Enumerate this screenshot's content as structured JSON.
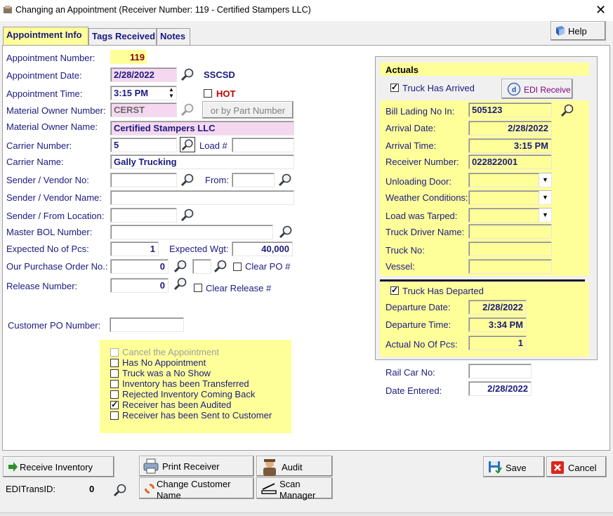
{
  "window": {
    "title": "Changing an Appointment  (Receiver Number: 119 - Certified Stampers LLC)"
  },
  "tabs": [
    "Appointment Info",
    "Tags Received",
    "Notes"
  ],
  "help_button": "Help",
  "form": {
    "appointment_number_label": "Appointment Number:",
    "appointment_number": "119",
    "appointment_date_label": "Appointment Date:",
    "appointment_date": "2/28/2022",
    "user_code": "SSCSD",
    "appointment_time_label": "Appointment Time:",
    "appointment_time": "3:15 PM",
    "hot_label": "HOT",
    "material_owner_number_label": "Material Owner Number:",
    "material_owner_number": "CERST",
    "part_number_button": "or by Part Number",
    "material_owner_name_label": "Material Owner Name:",
    "material_owner_name": "Certified Stampers LLC",
    "carrier_number_label": "Carrier Number:",
    "carrier_number": "5",
    "load_label": "Load #",
    "load_value": "",
    "carrier_name_label": "Carrier Name:",
    "carrier_name": "Gally Trucking",
    "sender_vendor_no_label": "Sender / Vendor No:",
    "sender_vendor_no": "",
    "from_label": "From:",
    "from_value": "",
    "sender_vendor_name_label": "Sender / Vendor Name:",
    "sender_vendor_name": "",
    "sender_from_location_label": "Sender / From Location:",
    "sender_from_location": "",
    "master_bol_label": "Master BOL Number:",
    "master_bol": "",
    "expected_pcs_label": "Expected No of Pcs:",
    "expected_pcs": "1",
    "expected_wgt_label": "Expected Wgt:",
    "expected_wgt": "40,000",
    "purchase_order_label": "Our Purchase Order No.:",
    "purchase_order": "0",
    "purchase_order_2": "",
    "clear_po_label": "Clear PO #",
    "release_number_label": "Release Number:",
    "release_number": "0",
    "clear_release_label": "Clear Release #",
    "customer_po_label": "Customer PO Number:",
    "customer_po": ""
  },
  "status_checks": [
    {
      "label": "Cancel the Appointment",
      "checked": false,
      "disabled": true
    },
    {
      "label": "Has No Appointment",
      "checked": false,
      "disabled": false
    },
    {
      "label": "Truck was a No Show",
      "checked": false,
      "disabled": false
    },
    {
      "label": "Inventory has been Transferred",
      "checked": false,
      "disabled": false
    },
    {
      "label": "Rejected Inventory Coming Back",
      "checked": false,
      "disabled": false
    },
    {
      "label": "Receiver has been Audited",
      "checked": true,
      "disabled": false
    },
    {
      "label": "Receiver has been Sent to Customer",
      "checked": false,
      "disabled": false
    }
  ],
  "actuals": {
    "title": "Actuals",
    "truck_arrived_label": "Truck Has Arrived",
    "edi_receive_button": "EDI Receive",
    "bill_lading_label": "Bill Lading No In:",
    "bill_lading": "505123",
    "arrival_date_label": "Arrival Date:",
    "arrival_date": "2/28/2022",
    "arrival_time_label": "Arrival Time:",
    "arrival_time": "3:15 PM",
    "receiver_number_label": "Receiver Number:",
    "receiver_number": "022822001",
    "unloading_door_label": "Unloading Door:",
    "weather_label": "Weather Conditions:",
    "tarped_label": "Load was Tarped:",
    "driver_name_label": "Truck Driver Name:",
    "truck_no_label": "Truck No:",
    "vessel_label": "Vessel:",
    "truck_departed_label": "Truck Has Departed",
    "departure_date_label": "Departure Date:",
    "departure_date": "2/28/2022",
    "departure_time_label": "Departure Time:",
    "departure_time": "3:34 PM",
    "actual_pcs_label": "Actual No Of Pcs:",
    "actual_pcs": "1"
  },
  "extra": {
    "rail_car_label": "Rail Car No:",
    "rail_car": "",
    "date_entered_label": "Date Entered:",
    "date_entered": "2/28/2022"
  },
  "bottom": {
    "receive_inventory": "Receive Inventory",
    "edi_trans_label": "EDITransID:",
    "edi_trans_value": "0",
    "print_receiver": "Print Receiver",
    "change_customer_name": "Change Customer Name",
    "audit": "Audit",
    "scan_manager": "Scan Manager",
    "save": "Save",
    "cancel": "Cancel"
  },
  "colors": {
    "label": "#1a1a80",
    "highlight": "#ffff99",
    "pink": "#f5d7ef"
  },
  "icons": [
    "app-icon",
    "close-icon",
    "help-book-icon",
    "magnifier-icon",
    "edi-icon",
    "receive-arrow-icon",
    "printer-icon",
    "auditor-icon",
    "refresh-icon",
    "scanner-icon",
    "save-disk-icon",
    "cancel-x-icon"
  ]
}
